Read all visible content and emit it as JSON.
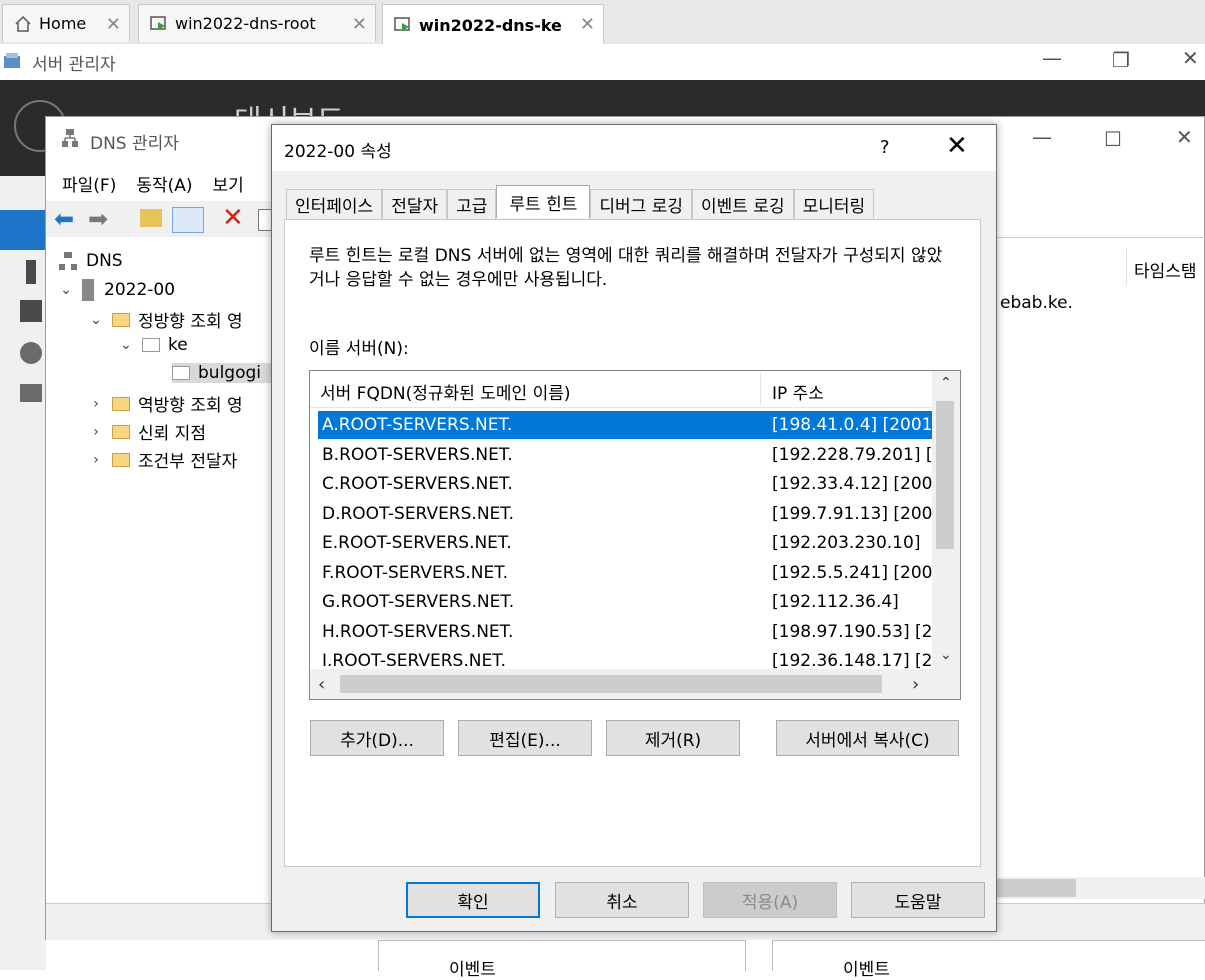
{
  "browser_tabs": [
    {
      "label": "Home"
    },
    {
      "label": "win2022-dns-root"
    },
    {
      "label": "win2022-dns-ke"
    }
  ],
  "server_manager": {
    "title": "서버 관리자",
    "header_partial": "대시보드"
  },
  "dns_manager": {
    "title": "DNS 관리자",
    "menu": [
      "파일(F)",
      "동작(A)",
      "보기"
    ],
    "tree": {
      "root": "DNS",
      "server": "2022-00",
      "forward": "정방향 조회 영",
      "zone": "ke",
      "subzone": "bulgogi",
      "reverse": "역방향 조회 영",
      "trust": "신뢰 지점",
      "conditional": "조건부 전달자"
    },
    "right_column_header": "타임스탬",
    "right_partial_text": "ebab.ke.",
    "events": [
      "이벤트",
      "이벤트"
    ]
  },
  "dialog": {
    "title": "2022-00 속성",
    "help_glyph": "?",
    "tabs": [
      "인터페이스",
      "전달자",
      "고급",
      "루트 힌트",
      "디버그 로깅",
      "이벤트 로깅",
      "모니터링"
    ],
    "selected_tab": "루트 힌트",
    "description": "루트 힌트는 로컬 DNS 서버에 없는 영역에 대한 쿼리를 해결하며 전달자가 구성되지 않았거나 응답할 수 없는 경우에만 사용됩니다.",
    "nameservers_label": "이름 서버(N):",
    "columns": {
      "fqdn": "서버 FQDN(정규화된 도메인 이름)",
      "ip": "IP 주소"
    },
    "rows": [
      {
        "fqdn": "A.ROOT-SERVERS.NET.",
        "ip": "[198.41.0.4] [2001"
      },
      {
        "fqdn": "B.ROOT-SERVERS.NET.",
        "ip": "[192.228.79.201] ["
      },
      {
        "fqdn": "C.ROOT-SERVERS.NET.",
        "ip": "[192.33.4.12] [200"
      },
      {
        "fqdn": "D.ROOT-SERVERS.NET.",
        "ip": "[199.7.91.13] [200"
      },
      {
        "fqdn": "E.ROOT-SERVERS.NET.",
        "ip": "[192.203.230.10]"
      },
      {
        "fqdn": "F.ROOT-SERVERS.NET.",
        "ip": "[192.5.5.241] [200"
      },
      {
        "fqdn": "G.ROOT-SERVERS.NET.",
        "ip": "[192.112.36.4]"
      },
      {
        "fqdn": "H.ROOT-SERVERS.NET.",
        "ip": "[198.97.190.53] [2"
      },
      {
        "fqdn": "I.ROOT-SERVERS.NET.",
        "ip": "[192.36.148.17] [2"
      }
    ],
    "list_buttons": {
      "add": "추가(D)...",
      "edit": "편집(E)...",
      "remove": "제거(R)",
      "copy": "서버에서 복사(C)"
    },
    "footer_buttons": {
      "ok": "확인",
      "cancel": "취소",
      "apply": "적용(A)",
      "help": "도움말"
    }
  },
  "colors": {
    "selection": "#0078d7",
    "dark_header": "#2b2b2b"
  }
}
